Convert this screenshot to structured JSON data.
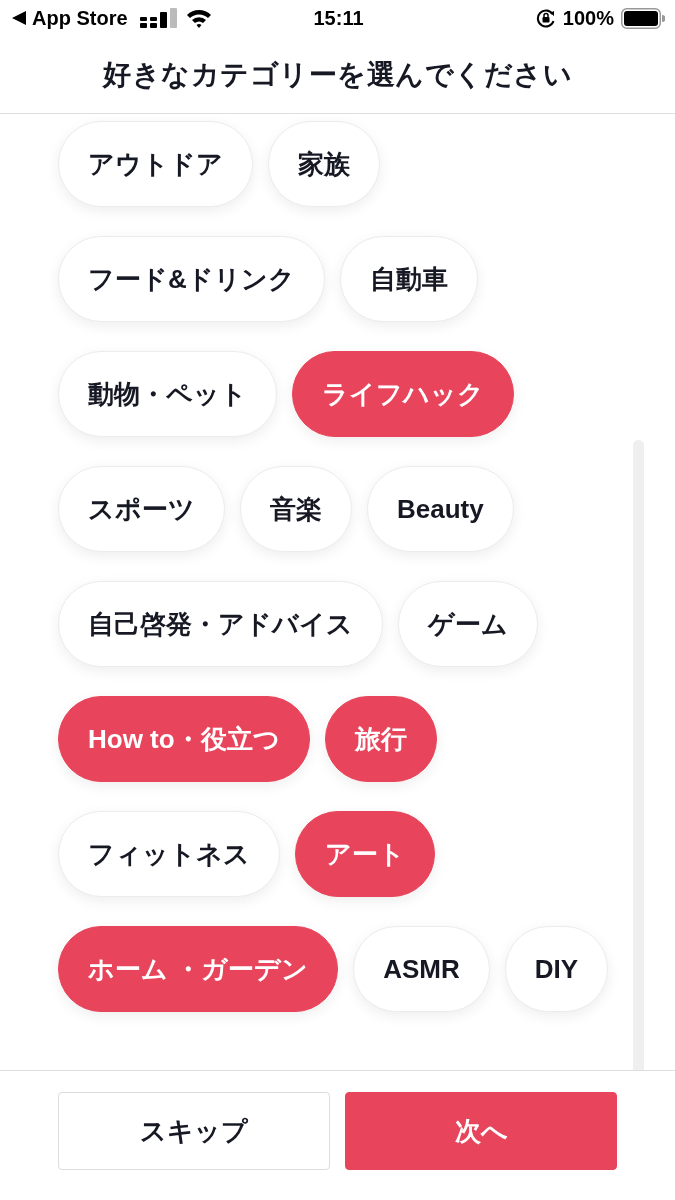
{
  "status_bar": {
    "back_label": "App Store",
    "time": "15:11",
    "battery": "100%"
  },
  "header": {
    "title": "好きなカテゴリーを選んでください"
  },
  "category_rows": [
    {
      "chips": [
        {
          "label": "アウトドア",
          "selected": false
        },
        {
          "label": "家族",
          "selected": false
        }
      ]
    },
    {
      "chips": [
        {
          "label": "フード&ドリンク",
          "selected": false
        },
        {
          "label": "自動車",
          "selected": false
        }
      ]
    },
    {
      "chips": [
        {
          "label": "動物・ペット",
          "selected": false
        },
        {
          "label": "ライフハック",
          "selected": true
        }
      ]
    },
    {
      "chips": [
        {
          "label": "スポーツ",
          "selected": false
        },
        {
          "label": "音楽",
          "selected": false
        },
        {
          "label": "Beauty",
          "selected": false
        }
      ]
    },
    {
      "chips": [
        {
          "label": "自己啓発・アドバイス",
          "selected": false
        },
        {
          "label": "ゲーム",
          "selected": false
        }
      ]
    },
    {
      "chips": [
        {
          "label": "How to・役立つ",
          "selected": true
        },
        {
          "label": "旅行",
          "selected": true
        }
      ]
    },
    {
      "chips": [
        {
          "label": "フィットネス",
          "selected": false
        },
        {
          "label": "アート",
          "selected": true
        }
      ]
    },
    {
      "chips": [
        {
          "label": "ホーム ・ガーデン",
          "selected": true
        },
        {
          "label": "ASMR",
          "selected": false
        },
        {
          "label": "DIY",
          "selected": false
        }
      ]
    }
  ],
  "footer": {
    "buttons": [
      {
        "label": "スキップ",
        "kind": "secondary"
      },
      {
        "label": "次へ",
        "kind": "primary"
      }
    ]
  }
}
